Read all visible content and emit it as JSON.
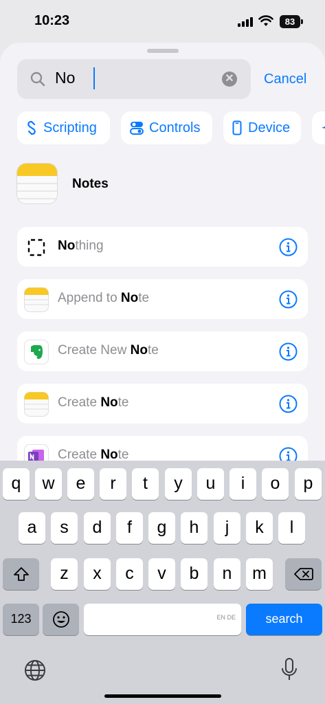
{
  "status_bar": {
    "time": "10:23",
    "battery": "83"
  },
  "search": {
    "value": "No",
    "cancel_label": "Cancel"
  },
  "chips": [
    {
      "label": "Scripting",
      "icon": "scripting-icon"
    },
    {
      "label": "Controls",
      "icon": "toggle-icon"
    },
    {
      "label": "Device",
      "icon": "phone-icon"
    }
  ],
  "app_result": {
    "label": "Notes",
    "icon": "notes-app-icon"
  },
  "actions": [
    {
      "prefix": "",
      "match": "No",
      "suffix": "thing",
      "icon": "nothing-icon"
    },
    {
      "prefix": "Append to ",
      "match": "No",
      "suffix": "te",
      "icon": "notes-app-icon"
    },
    {
      "prefix": "Create New ",
      "match": "No",
      "suffix": "te",
      "icon": "evernote-icon"
    },
    {
      "prefix": "Create ",
      "match": "No",
      "suffix": "te",
      "icon": "notes-app-icon"
    },
    {
      "prefix": "Create ",
      "match": "No",
      "suffix": "te",
      "icon": "onenote-icon"
    }
  ],
  "keyboard": {
    "row1": [
      "q",
      "w",
      "e",
      "r",
      "t",
      "y",
      "u",
      "i",
      "o",
      "p"
    ],
    "row2": [
      "a",
      "s",
      "d",
      "f",
      "g",
      "h",
      "j",
      "k",
      "l"
    ],
    "row3": [
      "z",
      "x",
      "c",
      "v",
      "b",
      "n",
      "m"
    ],
    "numbers_label": "123",
    "space_hint": "EN DE",
    "search_label": "search"
  },
  "colors": {
    "accent": "#0a7aff",
    "notes_yellow": "#f8c825",
    "evernote_green": "#1fa84f",
    "onenote_purple": "#7b3fbf"
  }
}
